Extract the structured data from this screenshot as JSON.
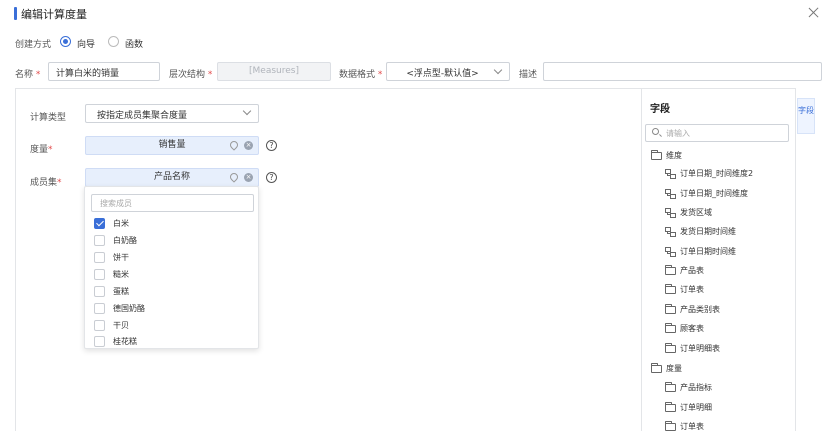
{
  "dialog": {
    "title": "编辑计算度量"
  },
  "create_mode": {
    "label": "创建方式",
    "options": [
      {
        "label": "向导",
        "selected": true
      },
      {
        "label": "函数",
        "selected": false
      }
    ]
  },
  "fields": {
    "name_label": "名称",
    "name_value": "计算白米的销量",
    "hierarchy_label": "层次结构",
    "hierarchy_value": "[Measures]",
    "format_label": "数据格式",
    "format_value": "<浮点型-默认值>",
    "desc_label": "描述",
    "desc_value": "",
    "required_mark": "*"
  },
  "calc": {
    "type_label": "计算类型",
    "type_value": "按指定成员集聚合度量",
    "measure_label": "度量",
    "measure_value": "销售量",
    "member_label": "成员集",
    "member_value": "产品名称",
    "help_glyph": "?",
    "clear_glyph": "×"
  },
  "dropdown": {
    "search_placeholder": "搜索成员",
    "items": [
      {
        "label": "白米",
        "checked": true
      },
      {
        "label": "白奶酪",
        "checked": false
      },
      {
        "label": "饼干",
        "checked": false
      },
      {
        "label": "糙米",
        "checked": false
      },
      {
        "label": "蛋糕",
        "checked": false
      },
      {
        "label": "德国奶酪",
        "checked": false
      },
      {
        "label": "干贝",
        "checked": false
      },
      {
        "label": "桂花糕",
        "checked": false
      }
    ]
  },
  "side": {
    "title": "字段",
    "tab_label": "字段",
    "search_placeholder": "请输入",
    "tree": [
      {
        "label": "维度",
        "icon": "folder-icon",
        "level": 0
      },
      {
        "label": "订单日期_时间维度2",
        "icon": "hierarchy-icon",
        "level": 1
      },
      {
        "label": "订单日期_时间维度",
        "icon": "hierarchy-icon",
        "level": 1
      },
      {
        "label": "发货区域",
        "icon": "hierarchy-icon",
        "level": 1
      },
      {
        "label": "发货日期时间维",
        "icon": "hierarchy-icon",
        "level": 1
      },
      {
        "label": "订单日期时间维",
        "icon": "hierarchy-icon",
        "level": 1
      },
      {
        "label": "产品表",
        "icon": "folder-icon",
        "level": 1
      },
      {
        "label": "订单表",
        "icon": "folder-icon",
        "level": 1
      },
      {
        "label": "产品类别表",
        "icon": "folder-icon",
        "level": 1
      },
      {
        "label": "顾客表",
        "icon": "folder-icon",
        "level": 1
      },
      {
        "label": "订单明细表",
        "icon": "folder-icon",
        "level": 1
      },
      {
        "label": "度量",
        "icon": "folder-icon",
        "level": 0
      },
      {
        "label": "产品指标",
        "icon": "folder-icon",
        "level": 1
      },
      {
        "label": "订单明细",
        "icon": "folder-icon",
        "level": 1
      },
      {
        "label": "订单表",
        "icon": "folder-icon",
        "level": 1
      }
    ]
  },
  "colors": {
    "accent": "#3a6fd8",
    "required": "#e34d4d",
    "tag_bg": "#e7effc"
  }
}
